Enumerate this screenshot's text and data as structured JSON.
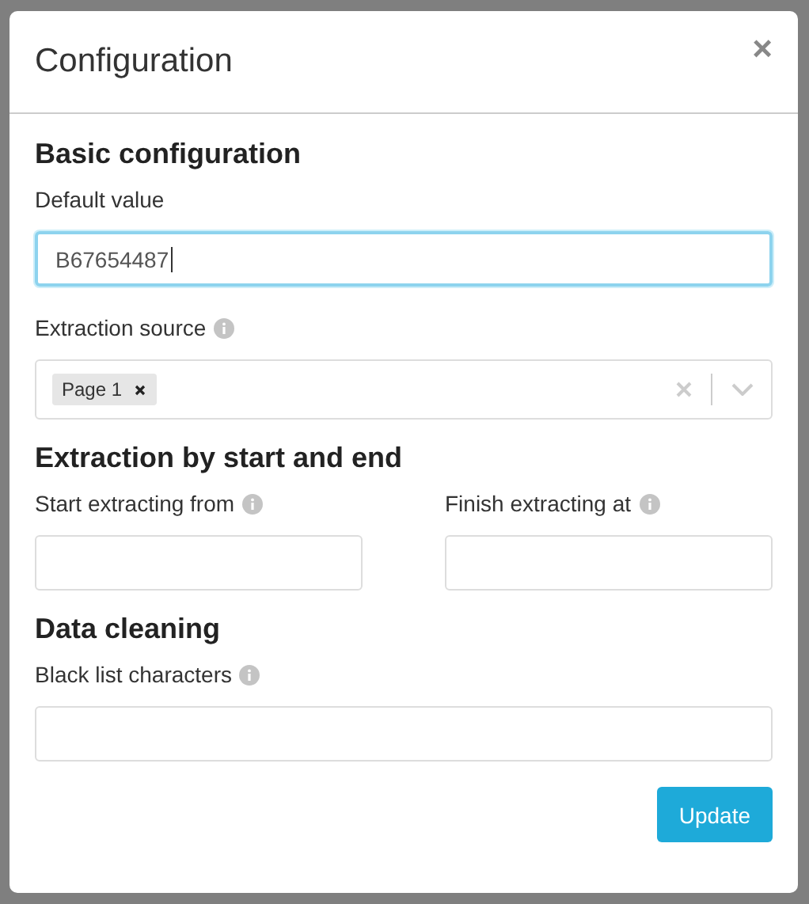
{
  "modal": {
    "title": "Configuration",
    "close": "×"
  },
  "sections": [
    {
      "heading": "Basic configuration",
      "columns": [
        {
          "fields": [
            {
              "kind": "text",
              "label": "Default value",
              "info": false,
              "value": "B67654487",
              "focused": true
            },
            {
              "kind": "multiselect",
              "label": "Extraction source",
              "info": true,
              "tags": [
                {
                  "label": "Page 1"
                }
              ]
            }
          ]
        }
      ]
    },
    {
      "heading": "Extraction by start and end",
      "columns": [
        {
          "fields": [
            {
              "kind": "text",
              "label": "Start extracting from",
              "info": true,
              "focused": false
            }
          ]
        },
        {
          "fields": [
            {
              "kind": "text",
              "label": "Finish extracting at",
              "info": true,
              "focused": false
            }
          ]
        }
      ]
    },
    {
      "heading": "Data cleaning",
      "columns": [
        {
          "fields": [
            {
              "kind": "text",
              "label": "Black list characters",
              "info": true,
              "focused": false
            }
          ]
        }
      ]
    }
  ],
  "actions": [
    {
      "label": "Update"
    }
  ]
}
